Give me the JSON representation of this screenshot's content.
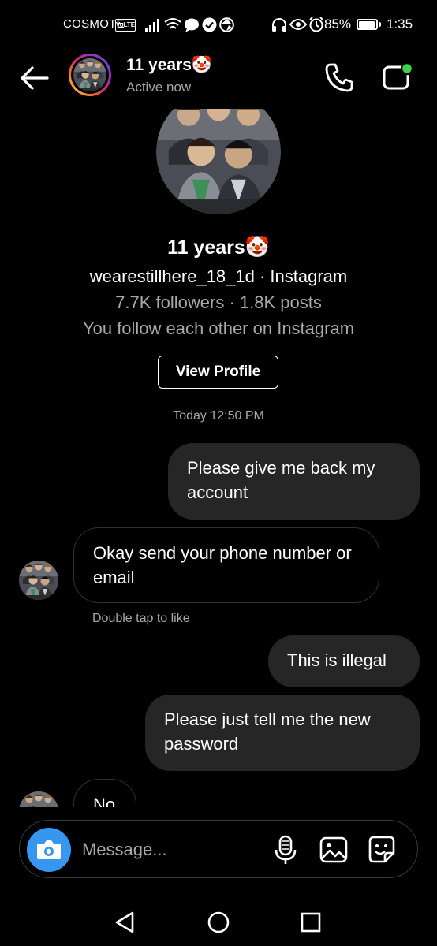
{
  "status_bar": {
    "carrier": "COSMOTE",
    "volte": "VoLTE",
    "battery_percent": "85%",
    "battery_level": 0.85,
    "time": "1:35"
  },
  "header": {
    "name": "11 years🤡",
    "status": "Active now"
  },
  "profile": {
    "name": "11 years🤡",
    "username_line": "wearestillhere_18_1d · Instagram",
    "stats": "7.7K followers · 1.8K posts",
    "mutual": "You follow each other on Instagram",
    "view_profile_label": "View Profile"
  },
  "thread": {
    "timestamp": "Today 12:50 PM",
    "messages": [
      {
        "sender": "me",
        "text": "Please give me back my account"
      },
      {
        "sender": "them",
        "text": "Okay send your phone number or email"
      },
      {
        "sender": "me",
        "text": "This is illegal"
      },
      {
        "sender": "me",
        "text": "Please just tell me the new password"
      },
      {
        "sender": "them",
        "text": "No"
      }
    ],
    "like_hint": "Double tap to like"
  },
  "composer": {
    "placeholder": "Message..."
  },
  "icons": {
    "accent": "#3797f0",
    "online_dot": "#3cd24a"
  }
}
